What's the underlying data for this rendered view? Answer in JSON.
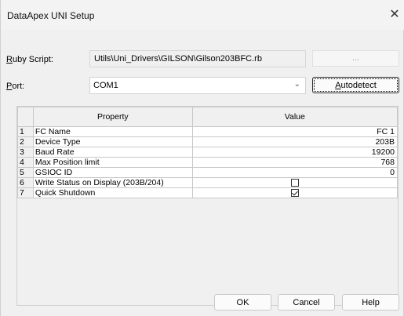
{
  "window": {
    "title": "DataApex UNI Setup",
    "close_glyph": "✕"
  },
  "ruby_script": {
    "label_accel": "R",
    "label_rest": "uby Script:",
    "value": "Utils\\Uni_Drivers\\GILSON\\Gilson203BFC.rb",
    "browse_label": "..."
  },
  "port": {
    "label_accel": "P",
    "label_rest": "ort:",
    "value": "COM1",
    "autodetect_accel": "A",
    "autodetect_rest": "utodetect"
  },
  "table": {
    "headers": [
      "",
      "Property",
      "Value"
    ],
    "rows": [
      {
        "num": "1",
        "property": "FC Name",
        "value": "FC 1",
        "kind": "text"
      },
      {
        "num": "2",
        "property": "Device Type",
        "value": "203B",
        "kind": "text"
      },
      {
        "num": "3",
        "property": "Baud Rate",
        "value": "19200",
        "kind": "text"
      },
      {
        "num": "4",
        "property": "Max Position limit",
        "value": "768",
        "kind": "text"
      },
      {
        "num": "5",
        "property": "GSIOC ID",
        "value": "0",
        "kind": "text"
      },
      {
        "num": "6",
        "property": "Write Status on Display (203B/204)",
        "value": false,
        "kind": "checkbox"
      },
      {
        "num": "7",
        "property": "Quick Shutdown",
        "value": true,
        "kind": "checkbox"
      }
    ]
  },
  "buttons": {
    "ok": "OK",
    "cancel": "Cancel",
    "help": "Help"
  }
}
